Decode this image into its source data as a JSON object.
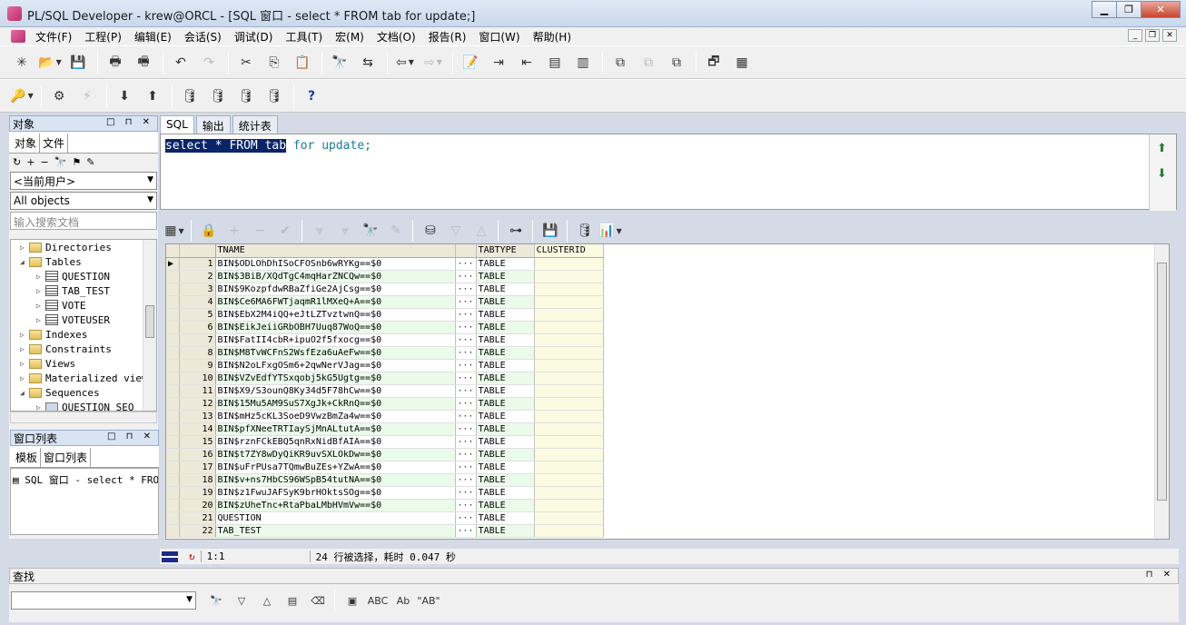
{
  "window": {
    "title": "PL/SQL Developer - krew@ORCL - [SQL 窗口 - select * FROM tab for update;]"
  },
  "menu": [
    "文件(F)",
    "工程(P)",
    "编辑(E)",
    "会话(S)",
    "调试(D)",
    "工具(T)",
    "宏(M)",
    "文档(O)",
    "报告(R)",
    "窗口(W)",
    "帮助(H)"
  ],
  "object_panel": {
    "header": "对象",
    "tabs": [
      "对象",
      "文件"
    ],
    "user_combo": "<当前用户>",
    "type_combo": "All objects",
    "search_placeholder": "输入搜索文档",
    "tree": [
      {
        "label": "Directories",
        "kind": "folder",
        "level": 0,
        "toggle": "▷"
      },
      {
        "label": "Tables",
        "kind": "folder",
        "level": 0,
        "toggle": "◢"
      },
      {
        "label": "QUESTION",
        "kind": "table",
        "level": 1,
        "toggle": "▷"
      },
      {
        "label": "TAB_TEST",
        "kind": "table",
        "level": 1,
        "toggle": "▷"
      },
      {
        "label": "VOTE",
        "kind": "table",
        "level": 1,
        "toggle": "▷"
      },
      {
        "label": "VOTEUSER",
        "kind": "table",
        "level": 1,
        "toggle": "▷"
      },
      {
        "label": "Indexes",
        "kind": "folder",
        "level": 0,
        "toggle": "▷"
      },
      {
        "label": "Constraints",
        "kind": "folder",
        "level": 0,
        "toggle": "▷"
      },
      {
        "label": "Views",
        "kind": "folder",
        "level": 0,
        "toggle": "▷"
      },
      {
        "label": "Materialized view",
        "kind": "folder",
        "level": 0,
        "toggle": "▷"
      },
      {
        "label": "Sequences",
        "kind": "folder",
        "level": 0,
        "toggle": "◢"
      },
      {
        "label": "QUESTION_SEQ",
        "kind": "seq",
        "level": 1,
        "toggle": "▷"
      }
    ]
  },
  "window_list": {
    "header": "窗口列表",
    "tabs": [
      "模板",
      "窗口列表"
    ],
    "item": "SQL 窗口 - select * FROM"
  },
  "editor": {
    "tabs": [
      "SQL",
      "输出",
      "统计表"
    ],
    "sql_selected": "select * FROM tab",
    "sql_rest": " for update;"
  },
  "grid": {
    "columns": [
      "TNAME",
      "TABTYPE",
      "CLUSTERID"
    ],
    "rows": [
      [
        "1",
        "BIN$ODLOhDhISoCFOSnb6wRYKg==$0",
        "TABLE"
      ],
      [
        "2",
        "BIN$3BiB/XQdTgC4mqHarZNCQw==$0",
        "TABLE"
      ],
      [
        "3",
        "BIN$9KozpfdwRBaZfiGe2AjCsg==$0",
        "TABLE"
      ],
      [
        "4",
        "BIN$Ce6MA6FWTjaqmR1lMXeQ+A==$0",
        "TABLE"
      ],
      [
        "5",
        "BIN$EbX2M4iQQ+eJtLZTvztwnQ==$0",
        "TABLE"
      ],
      [
        "6",
        "BIN$EikJeiiGRbOBH7Uuq87WoQ==$0",
        "TABLE"
      ],
      [
        "7",
        "BIN$FatII4cbR+ipuO2f5fxocg==$0",
        "TABLE"
      ],
      [
        "8",
        "BIN$M8TvWCFnS2WsfEza6uAeFw==$0",
        "TABLE"
      ],
      [
        "9",
        "BIN$N2oLFxgOSm6+2qwNerVJag==$0",
        "TABLE"
      ],
      [
        "10",
        "BIN$VZvEdfYTSxqobj5kG5Ugtg==$0",
        "TABLE"
      ],
      [
        "11",
        "BIN$X9/S3ounQ8Ky34d5F78hCw==$0",
        "TABLE"
      ],
      [
        "12",
        "BIN$15Mu5AM9SuS7XgJk+CkRnQ==$0",
        "TABLE"
      ],
      [
        "13",
        "BIN$mHz5cKL3SoeD9VwzBmZa4w==$0",
        "TABLE"
      ],
      [
        "14",
        "BIN$pfXNeeTRTIaySjMnALtutA==$0",
        "TABLE"
      ],
      [
        "15",
        "BIN$rznFCkEBQ5qnRxNidBfAIA==$0",
        "TABLE"
      ],
      [
        "16",
        "BIN$t7ZY8wDyQiKR9uvSXLOkDw==$0",
        "TABLE"
      ],
      [
        "17",
        "BIN$uFrPUsa7TQmwBuZEs+YZwA==$0",
        "TABLE"
      ],
      [
        "18",
        "BIN$v+ns7HbCS96WSpB54tutNA==$0",
        "TABLE"
      ],
      [
        "19",
        "BIN$z1FwuJAFSyK9brHOktsSOg==$0",
        "TABLE"
      ],
      [
        "20",
        "BIN$zUheTnc+RtaPbaLMbHVmVw==$0",
        "TABLE"
      ],
      [
        "21",
        "QUESTION",
        "TABLE"
      ],
      [
        "22",
        "TAB_TEST",
        "TABLE"
      ]
    ]
  },
  "status": {
    "position": "1:1",
    "message": "24 行被选择，耗时 0.047 秒"
  },
  "find_panel": {
    "header": "查找"
  }
}
